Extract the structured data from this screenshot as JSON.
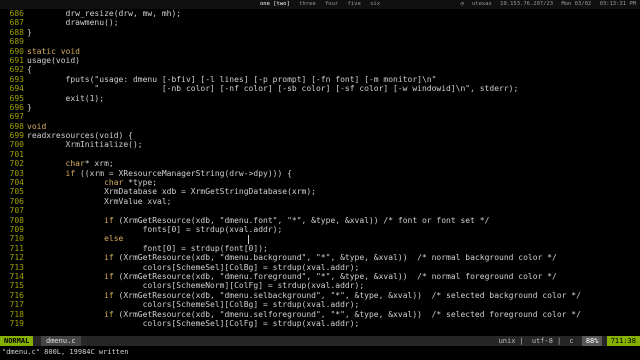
{
  "topbar": {
    "tags": [
      "one [two]",
      "three",
      "four",
      "five",
      "six"
    ],
    "active_tag": "one [two]",
    "status": [
      "utexas",
      "10.153.76.207/23",
      "Mon 03/02",
      "03:13:31 PM"
    ]
  },
  "editor": {
    "lines": [
      {
        "n": "686",
        "t": "        drw_resize(drw, mw, mh);"
      },
      {
        "n": "687",
        "t": "        drawmenu();"
      },
      {
        "n": "688",
        "t": "}"
      },
      {
        "n": "689",
        "t": ""
      },
      {
        "n": "690",
        "t": "static void"
      },
      {
        "n": "691",
        "t": "usage(void)"
      },
      {
        "n": "692",
        "t": "{"
      },
      {
        "n": "693",
        "t": "        fputs(\"usage: dmenu [-bfiv] [-l lines] [-p prompt] [-fn font] [-m monitor]\\n\""
      },
      {
        "n": "694",
        "t": "              \"             [-nb color] [-nf color] [-sb color] [-sf color] [-w windowid]\\n\", stderr);"
      },
      {
        "n": "695",
        "t": "        exit(1);"
      },
      {
        "n": "696",
        "t": "}"
      },
      {
        "n": "697",
        "t": ""
      },
      {
        "n": "698",
        "t": "void"
      },
      {
        "n": "699",
        "t": "readxresources(void) {"
      },
      {
        "n": "700",
        "t": "        XrmInitialize();"
      },
      {
        "n": "701",
        "t": ""
      },
      {
        "n": "702",
        "t": "        char* xrm;"
      },
      {
        "n": "703",
        "t": "        if ((xrm = XResourceManagerString(drw->dpy))) {"
      },
      {
        "n": "704",
        "t": "                char *type;"
      },
      {
        "n": "705",
        "t": "                XrmDatabase xdb = XrmGetStringDatabase(xrm);"
      },
      {
        "n": "706",
        "t": "                XrmValue xval;"
      },
      {
        "n": "707",
        "t": ""
      },
      {
        "n": "708",
        "t": "                if (XrmGetResource(xdb, \"dmenu.font\", \"*\", &type, &xval)) /* font or font set */"
      },
      {
        "n": "709",
        "t": "                        fonts[0] = strdup(xval.addr);"
      },
      {
        "n": "710",
        "t": "                else"
      },
      {
        "n": "711",
        "t": "                        font[0] = strdup(font[0]);"
      },
      {
        "n": "712",
        "t": "                if (XrmGetResource(xdb, \"dmenu.background\", \"*\", &type, &xval))  /* normal background color */"
      },
      {
        "n": "713",
        "t": "                        colors[SchemeSel][ColBg] = strdup(xval.addr);"
      },
      {
        "n": "714",
        "t": "                if (XrmGetResource(xdb, \"dmenu.foreground\", \"*\", &type, &xval))  /* normal foreground color */"
      },
      {
        "n": "715",
        "t": "                        colors[SchemeNorm][ColFg] = strdup(xval.addr);"
      },
      {
        "n": "716",
        "t": "                if (XrmGetResource(xdb, \"dmenu.selbackground\", \"*\", &type, &xval))  /* selected background color */"
      },
      {
        "n": "717",
        "t": "                        colors[SchemeSel][ColBg] = strdup(xval.addr);"
      },
      {
        "n": "718",
        "t": "                if (XrmGetResource(xdb, \"dmenu.selforeground\", \"*\", &type, &xval))  /* selected foreground color */"
      },
      {
        "n": "719",
        "t": "                        colors[SchemeSel][ColFg] = strdup(xval.addr);"
      }
    ]
  },
  "statusline": {
    "mode": "NORMAL",
    "filename": "dmenu.c",
    "format": "unix",
    "encoding": "utf-8",
    "filetype": "c",
    "percent": "88%",
    "position": "711:38"
  },
  "message": "\"dmenu.c\" 800L, 19984C written",
  "colors": {
    "line_number": "#a0a000",
    "mode_bg": "#87af00",
    "keyword": "#d7af5f"
  }
}
